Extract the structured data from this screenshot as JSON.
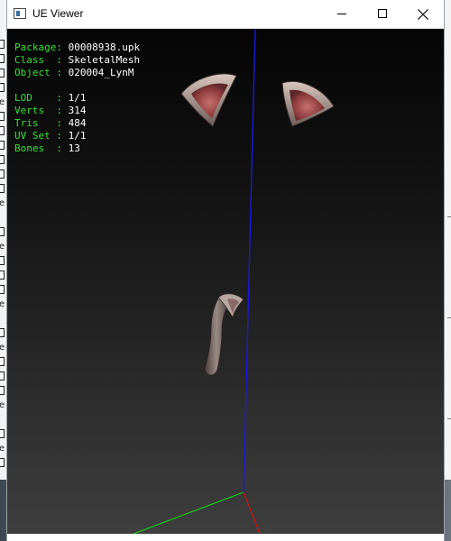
{
  "window": {
    "title": "UE Viewer"
  },
  "info": [
    {
      "key": "Package:",
      "value": "00008938.upk"
    },
    {
      "key": "Class  :",
      "value": "SkeletalMesh"
    },
    {
      "key": "Object :",
      "value": "020004_LynM"
    }
  ],
  "stats": [
    {
      "key": "LOD    :",
      "value": "1/1"
    },
    {
      "key": "Verts  :",
      "value": "314"
    },
    {
      "key": "Tris   :",
      "value": "484"
    },
    {
      "key": "UV Set :",
      "value": "1/1"
    },
    {
      "key": "Bones  :",
      "value": "13"
    }
  ],
  "colors": {
    "label_green": "#33e233",
    "axis_x": "#d01010",
    "axis_y": "#10d010",
    "axis_z": "#1010e0"
  },
  "icons": [
    "app-icon",
    "minimize-icon",
    "maximize-icon",
    "close-icon"
  ]
}
